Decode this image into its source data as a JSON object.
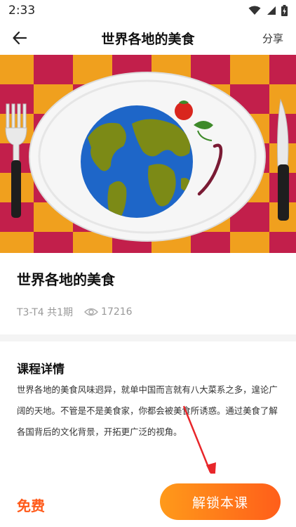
{
  "status_bar": {
    "time": "2:33",
    "icons": [
      "wifi-icon",
      "signal-icon",
      "battery-icon"
    ]
  },
  "header": {
    "title": "世界各地的美食",
    "share_label": "分享",
    "back_icon": "arrow-left-icon"
  },
  "hero_image": {
    "description_icon": "world-food-plate-illustration"
  },
  "course": {
    "title": "世界各地的美食",
    "level_info": "T3-T4 共1期",
    "view_count": "17216",
    "view_icon": "eye-icon"
  },
  "details": {
    "section_title": "课程详情",
    "text": "世界各地的美食风味迥异，就单中国而言就有八大菜系之多，遑论广阔的天地。不管是不是美食家，你都会被美食所诱惑。通过美食了解各国背后的文化背景，开拓更广泛的视角。"
  },
  "bottom_bar": {
    "price_label": "免费",
    "unlock_label": "解锁本课"
  },
  "colors": {
    "accent_orange": "#ff5a1a",
    "gradient_start": "#ff9a1a",
    "gradient_end": "#ff5e1a",
    "annotation_red": "#e8262a",
    "checker_orange": "#f0a01e",
    "checker_crimson": "#c21f4b"
  }
}
